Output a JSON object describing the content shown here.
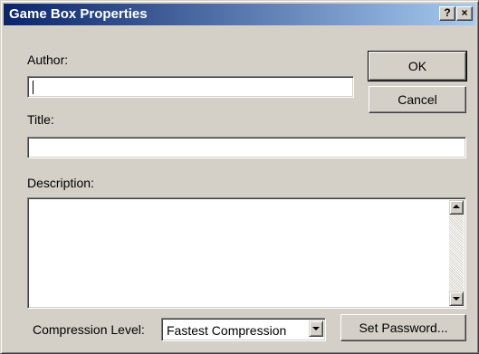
{
  "window": {
    "title": "Game Box Properties",
    "help_glyph": "?",
    "close_glyph": "×"
  },
  "form": {
    "author_label": "Author:",
    "author_value": "",
    "title_label": "Title:",
    "title_value": "",
    "description_label": "Description:",
    "description_value": "",
    "compression_label": "Compression Level:",
    "compression_selected": "Fastest Compression"
  },
  "buttons": {
    "ok": "OK",
    "cancel": "Cancel",
    "set_password": "Set Password..."
  },
  "icons": {
    "help": "question-mark-icon",
    "close": "close-icon",
    "scroll_up": "arrow-up-icon",
    "scroll_down": "arrow-down-icon",
    "dropdown": "chevron-down-icon"
  },
  "colors": {
    "titlebar_start": "#0a246a",
    "titlebar_end": "#a6caf0",
    "face": "#d4d0c8"
  }
}
